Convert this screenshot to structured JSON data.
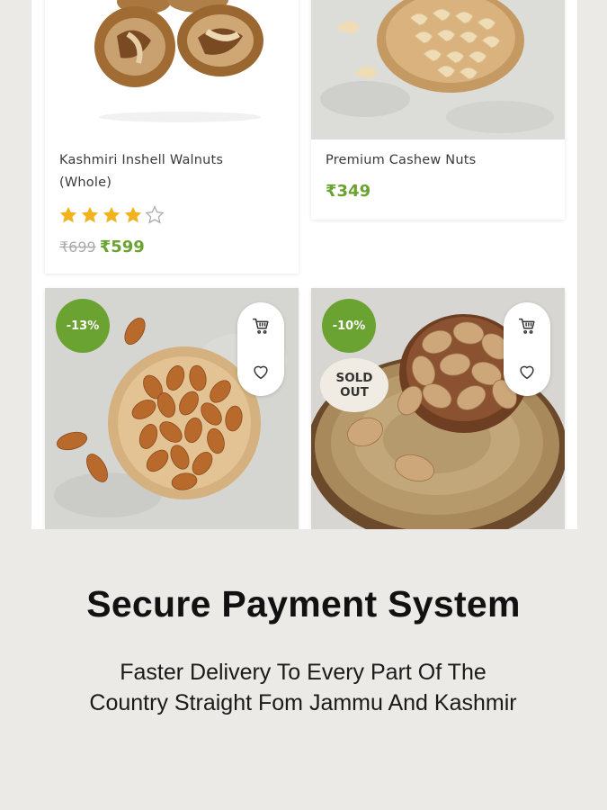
{
  "products": [
    {
      "name": "Kashmiri Inshell Walnuts (Whole)",
      "rating": 4,
      "max_rating": 5,
      "old_price": "₹699",
      "price": "₹599"
    },
    {
      "name": "Premium Cashew Nuts",
      "price": "₹349"
    },
    {
      "discount_badge": "-13%",
      "actions": [
        "cart-icon",
        "heart-icon"
      ]
    },
    {
      "discount_badge": "-10%",
      "sold_out": "SOLD OUT",
      "actions": [
        "cart-icon",
        "heart-icon"
      ]
    }
  ],
  "feature": {
    "title": "Secure Payment System",
    "description": "Faster Delivery To Every Part Of The Country Straight Fom Jammu And Kashmir"
  },
  "colors": {
    "accent_green": "#6aa332",
    "star_gold": "#f2b21b",
    "page_background": "#ebeae6"
  }
}
